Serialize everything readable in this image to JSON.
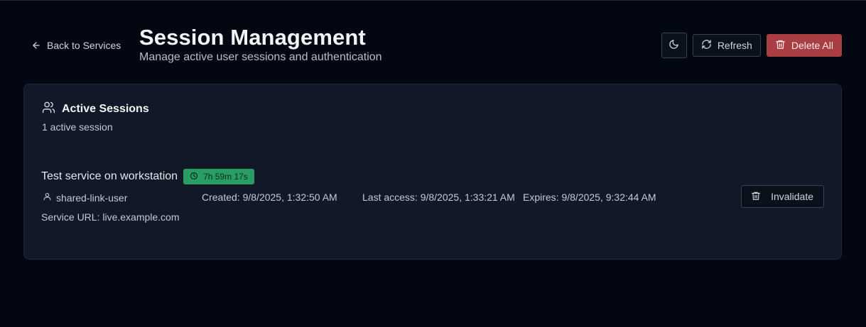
{
  "header": {
    "back_label": "Back to Services",
    "title": "Session Management",
    "subtitle": "Manage active user sessions and authentication",
    "refresh_label": "Refresh",
    "delete_all_label": "Delete All"
  },
  "card": {
    "title": "Active Sessions",
    "count_text": "1 active session"
  },
  "sessions": [
    {
      "name": "Test service on workstation",
      "ttl": "7h 59m 17s",
      "user": "shared-link-user",
      "created": "Created: 9/8/2025, 1:32:50 AM",
      "last_access": "Last access: 9/8/2025, 1:33:21 AM",
      "expires": "Expires: 9/8/2025, 9:32:44 AM",
      "service_url": "Service URL: live.example.com",
      "invalidate_label": "Invalidate"
    }
  ],
  "icons": {
    "back": "arrow-left-icon",
    "theme": "moon-icon",
    "refresh": "refresh-icon",
    "delete": "trash-icon",
    "sessions": "users-icon",
    "ttl": "clock-icon",
    "user": "user-icon"
  },
  "colors": {
    "background": "#030712",
    "card": "#111827",
    "danger": "#a93f45",
    "badge": "#2a9d63"
  }
}
